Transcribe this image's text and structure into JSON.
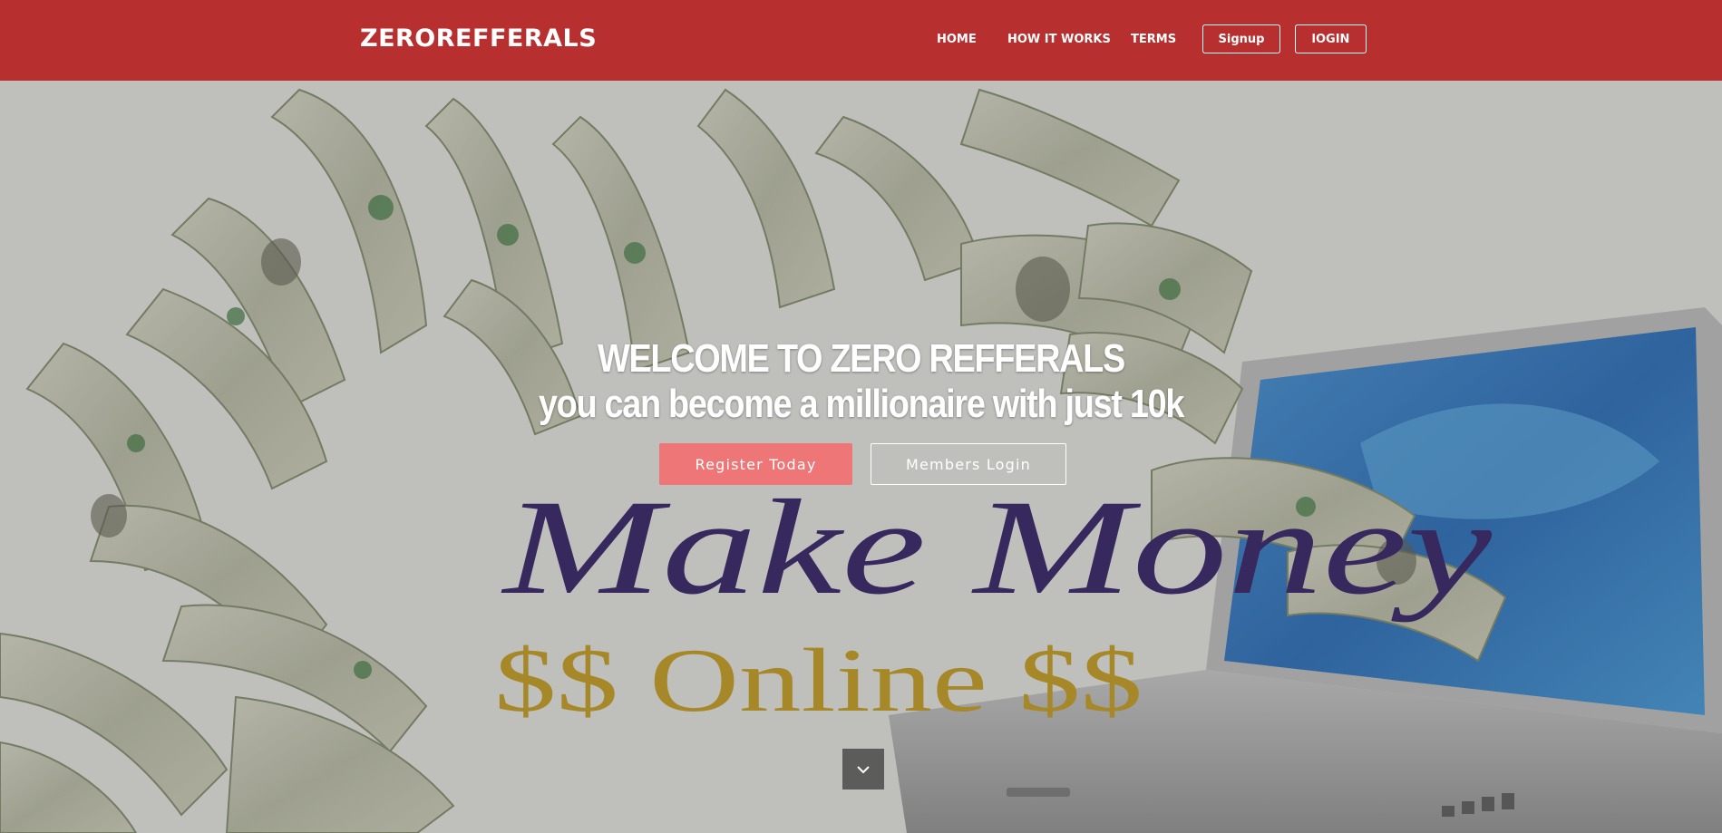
{
  "navbar": {
    "brand": "ZEROREFFERALS",
    "links": {
      "home": "HOME",
      "how_it_works": "HOW IT WORKS",
      "terms": "TERMS"
    },
    "buttons": {
      "signup": "Signup",
      "login": "lOGIN"
    },
    "background_color": "#b82f2f"
  },
  "hero": {
    "title": "WELCOME TO ZERO REFFERALS",
    "subtitle": "you can become a millionaire with just 10k",
    "register_button": "Register Today",
    "login_button": "Members Login",
    "register_color": "#ef7676",
    "background_image": {
      "headline": "Make Money",
      "tagline": "$$ Online $$",
      "headline_color": "#2a1560",
      "tagline_color": "#c49a16"
    },
    "scroll_icon": "chevron-down-icon"
  }
}
